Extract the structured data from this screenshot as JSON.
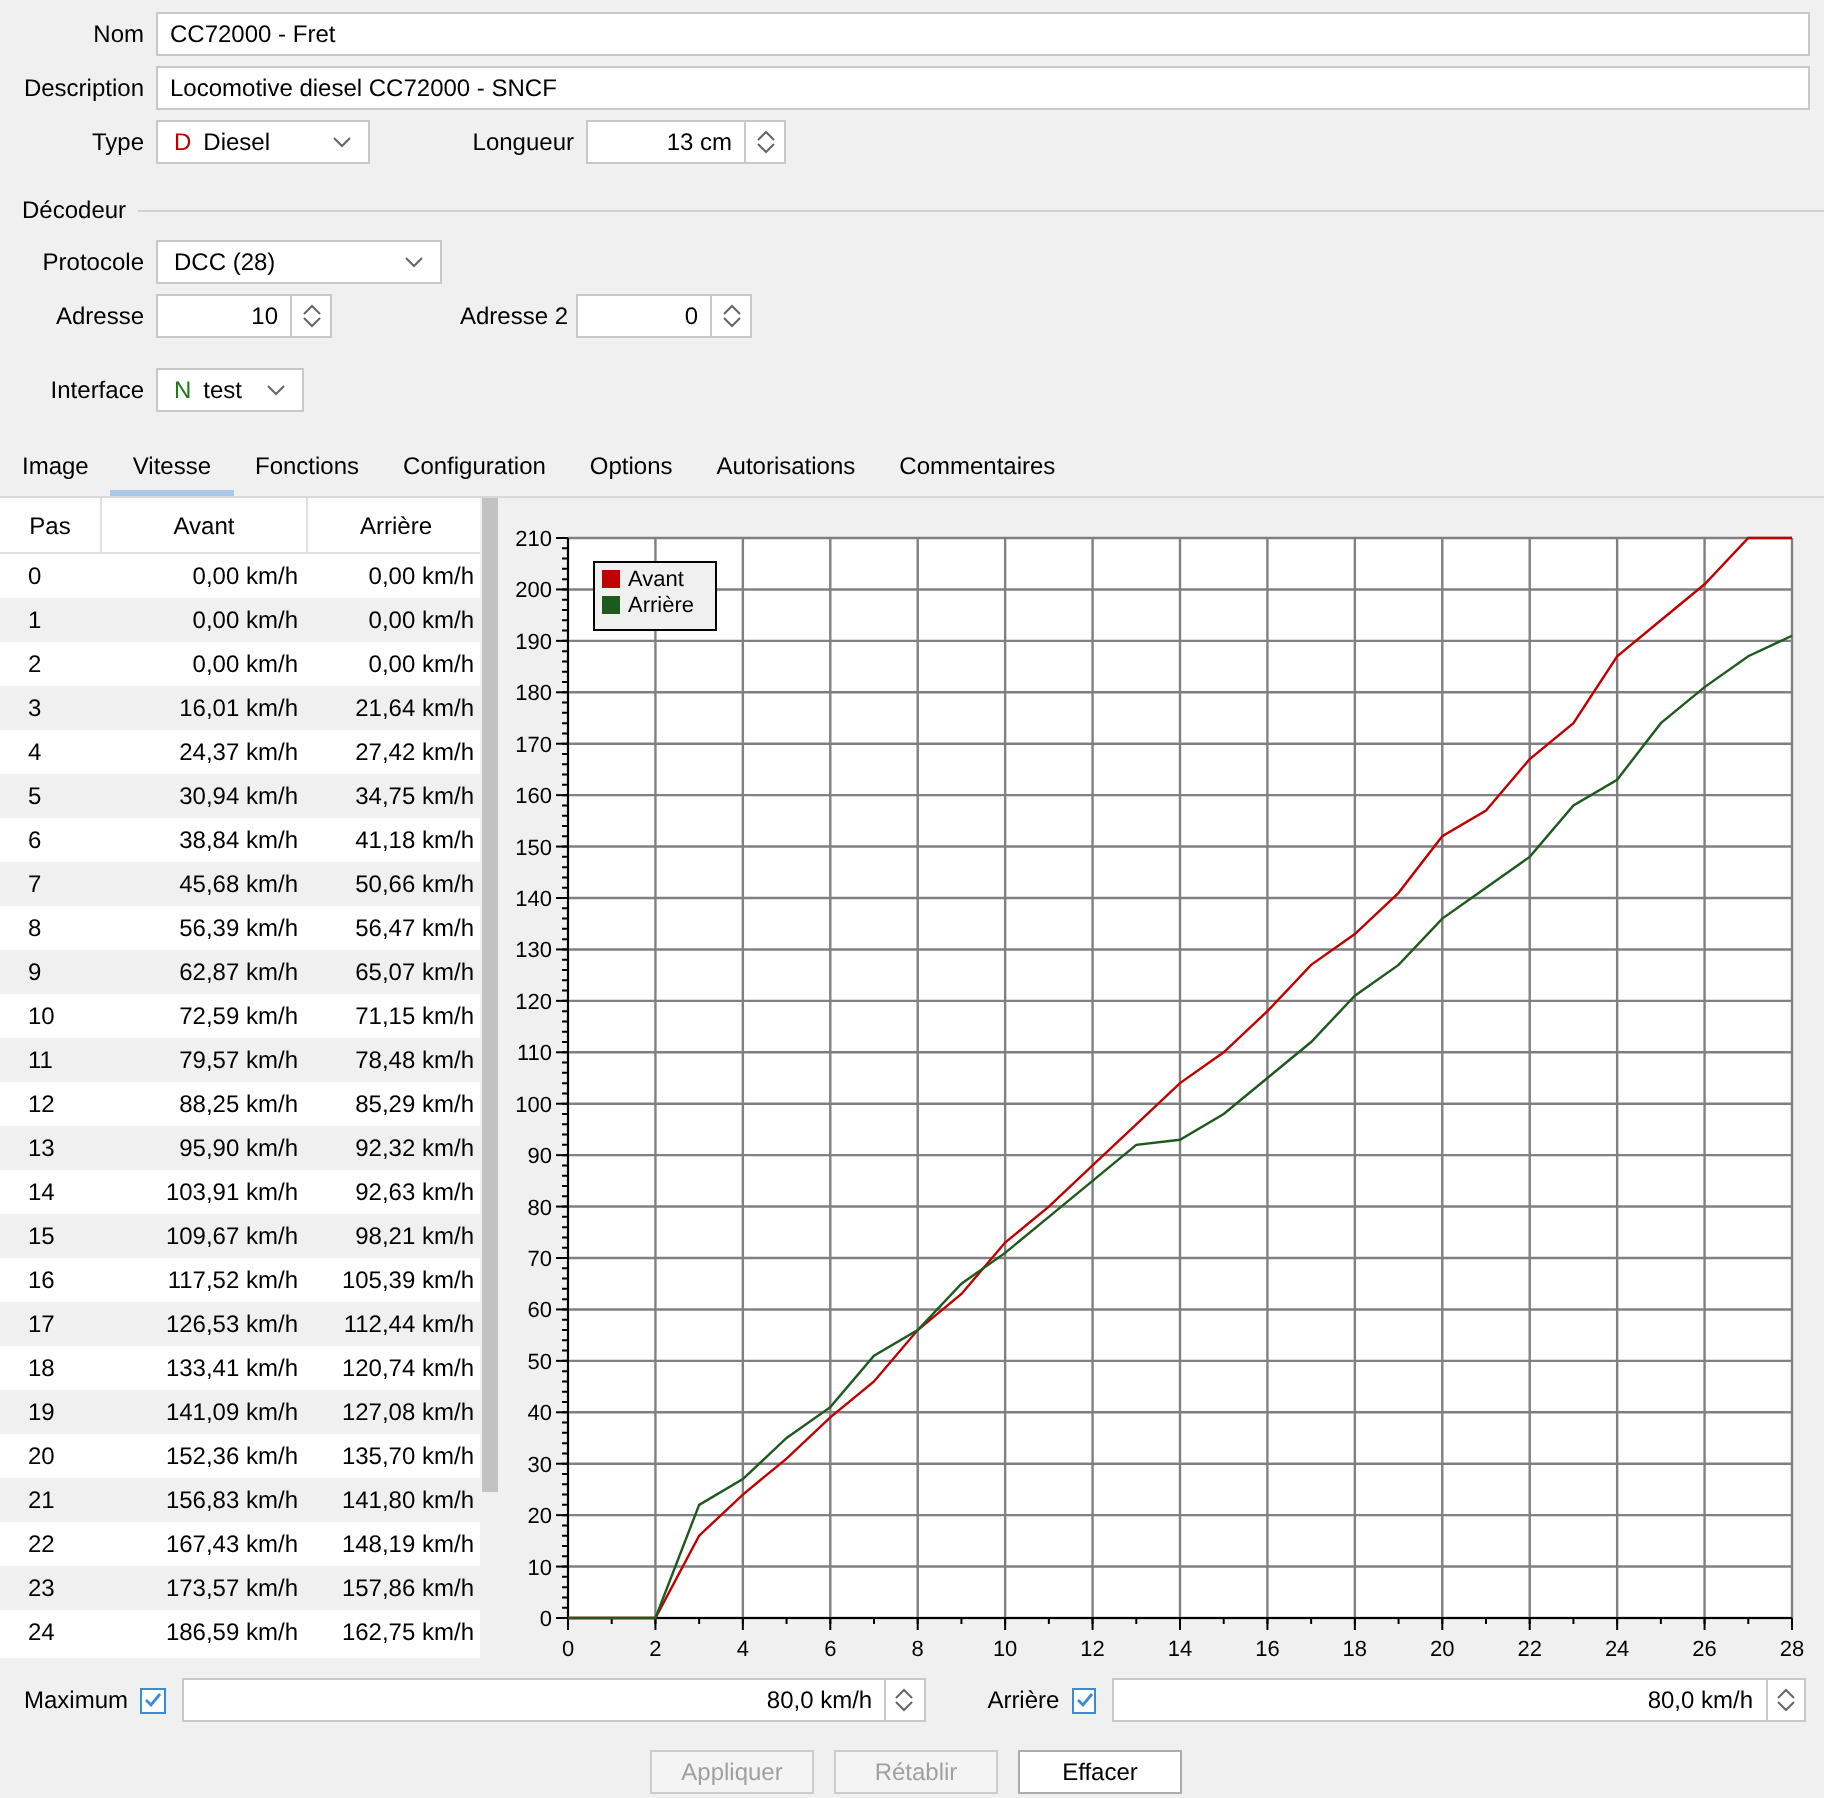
{
  "form": {
    "name": {
      "label": "Nom",
      "value": "CC72000 - Fret"
    },
    "description": {
      "label": "Description",
      "value": "Locomotive diesel CC72000 - SNCF"
    },
    "type": {
      "label": "Type",
      "letter": "D",
      "value": "Diesel"
    },
    "length": {
      "label": "Longueur",
      "value": "13 cm"
    }
  },
  "decoder": {
    "title": "Décodeur",
    "protocol": {
      "label": "Protocole",
      "value": "DCC (28)"
    },
    "address": {
      "label": "Adresse",
      "value": "10"
    },
    "address2": {
      "label": "Adresse 2",
      "value": "0"
    },
    "interface": {
      "label": "Interface",
      "letter": "N",
      "value": "test"
    }
  },
  "tabs": [
    {
      "label": "Image",
      "selected": false
    },
    {
      "label": "Vitesse",
      "selected": true
    },
    {
      "label": "Fonctions",
      "selected": false
    },
    {
      "label": "Configuration",
      "selected": false
    },
    {
      "label": "Options",
      "selected": false
    },
    {
      "label": "Autorisations",
      "selected": false
    },
    {
      "label": "Commentaires",
      "selected": false
    }
  ],
  "table": {
    "columns": [
      "Pas",
      "Avant",
      "Arrière"
    ],
    "rows": [
      [
        "0",
        "0,00 km/h",
        "0,00 km/h"
      ],
      [
        "1",
        "0,00 km/h",
        "0,00 km/h"
      ],
      [
        "2",
        "0,00 km/h",
        "0,00 km/h"
      ],
      [
        "3",
        "16,01 km/h",
        "21,64 km/h"
      ],
      [
        "4",
        "24,37 km/h",
        "27,42 km/h"
      ],
      [
        "5",
        "30,94 km/h",
        "34,75 km/h"
      ],
      [
        "6",
        "38,84 km/h",
        "41,18 km/h"
      ],
      [
        "7",
        "45,68 km/h",
        "50,66 km/h"
      ],
      [
        "8",
        "56,39 km/h",
        "56,47 km/h"
      ],
      [
        "9",
        "62,87 km/h",
        "65,07 km/h"
      ],
      [
        "10",
        "72,59 km/h",
        "71,15 km/h"
      ],
      [
        "11",
        "79,57 km/h",
        "78,48 km/h"
      ],
      [
        "12",
        "88,25 km/h",
        "85,29 km/h"
      ],
      [
        "13",
        "95,90 km/h",
        "92,32 km/h"
      ],
      [
        "14",
        "103,91 km/h",
        "92,63 km/h"
      ],
      [
        "15",
        "109,67 km/h",
        "98,21 km/h"
      ],
      [
        "16",
        "117,52 km/h",
        "105,39 km/h"
      ],
      [
        "17",
        "126,53 km/h",
        "112,44 km/h"
      ],
      [
        "18",
        "133,41 km/h",
        "120,74 km/h"
      ],
      [
        "19",
        "141,09 km/h",
        "127,08 km/h"
      ],
      [
        "20",
        "152,36 km/h",
        "135,70 km/h"
      ],
      [
        "21",
        "156,83 km/h",
        "141,80 km/h"
      ],
      [
        "22",
        "167,43 km/h",
        "148,19 km/h"
      ],
      [
        "23",
        "173,57 km/h",
        "157,86 km/h"
      ],
      [
        "24",
        "186,59 km/h",
        "162,75 km/h"
      ]
    ]
  },
  "chart": {
    "chart_data": {
      "type": "line",
      "x": [
        0,
        1,
        2,
        3,
        4,
        5,
        6,
        7,
        8,
        9,
        10,
        11,
        12,
        13,
        14,
        15,
        16,
        17,
        18,
        19,
        20,
        21,
        22,
        23,
        24,
        25,
        26,
        27,
        28
      ],
      "series": [
        {
          "name": "Avant",
          "color": "#c00000",
          "values": [
            0,
            0,
            0,
            16,
            24,
            31,
            39,
            46,
            56,
            63,
            73,
            80,
            88,
            96,
            104,
            110,
            118,
            127,
            133,
            141,
            152,
            157,
            167,
            174,
            187,
            194,
            201,
            210,
            210
          ]
        },
        {
          "name": "Arrière",
          "color": "#1e5a1e",
          "values": [
            0,
            0,
            0,
            22,
            27,
            35,
            41,
            51,
            56,
            65,
            71,
            78,
            85,
            92,
            93,
            98,
            105,
            112,
            121,
            127,
            136,
            142,
            148,
            158,
            163,
            174,
            181,
            187,
            191
          ]
        }
      ],
      "grid": true,
      "legend": true,
      "xlim": [
        0,
        28
      ],
      "ylim": [
        0,
        210
      ],
      "xticks": [
        0,
        2,
        4,
        6,
        8,
        10,
        12,
        14,
        16,
        18,
        20,
        22,
        24,
        26,
        28
      ],
      "yticks": [
        0,
        10,
        20,
        30,
        40,
        50,
        60,
        70,
        80,
        90,
        100,
        110,
        120,
        130,
        140,
        150,
        160,
        170,
        180,
        190,
        200,
        210
      ]
    }
  },
  "maximum": {
    "label": "Maximum",
    "checked": true,
    "value": "80,0 km/h"
  },
  "reverse": {
    "label": "Arrière",
    "checked": true,
    "value": "80,0 km/h"
  },
  "buttons": [
    {
      "label": "Appliquer",
      "disabled": true
    },
    {
      "label": "Rétablir",
      "disabled": true
    },
    {
      "label": "Effacer",
      "disabled": false
    }
  ]
}
